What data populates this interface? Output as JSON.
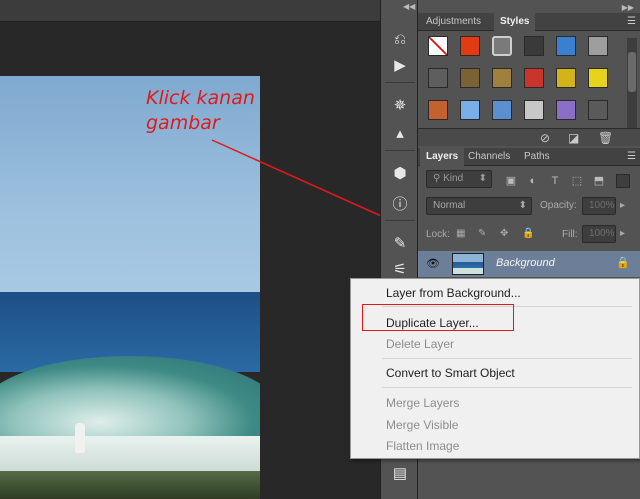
{
  "annotation": {
    "line1": "Klick kanan",
    "line2": "gambar",
    "color": "#e0191b"
  },
  "adjustments_panel": {
    "tabs": [
      {
        "label": "Adjustments",
        "active": false
      },
      {
        "label": "Styles",
        "active": true
      }
    ],
    "menu_icon": "panel-menu-icon",
    "style_swatches": [
      [
        "#ffffff",
        "#e23b12",
        "#7a7a7a",
        "#3a3a3a",
        "#3a7fd0",
        "#9e9e9e"
      ],
      [
        "#5e5e5e",
        "#7a6236",
        "#a0803c",
        "#c9352a",
        "#d4b21a",
        "#e7d21c"
      ],
      [
        "#c4622d",
        "#7aaee8",
        "#5b8fcf",
        "#c7c7c7",
        "#8b6ec7",
        "#5a5a5a"
      ]
    ],
    "footer_icons": [
      "no-style-icon",
      "new-style-icon",
      "delete-style-icon"
    ]
  },
  "layers_panel": {
    "tabs": [
      {
        "label": "Layers",
        "active": true
      },
      {
        "label": "Channels",
        "active": false
      },
      {
        "label": "Paths",
        "active": false
      }
    ],
    "filter_kind": "Kind",
    "blend_mode": "Normal",
    "opacity_label": "Opacity:",
    "opacity_value": "100%",
    "lock_label": "Lock:",
    "fill_label": "Fill:",
    "fill_value": "100%",
    "layer": {
      "name": "Background",
      "visible": true,
      "locked": true
    }
  },
  "context_menu": {
    "items": [
      {
        "label": "Layer from Background...",
        "enabled": true
      },
      {
        "label": "Duplicate Layer...",
        "enabled": true,
        "highlighted": true
      },
      {
        "label": "Delete Layer",
        "enabled": false
      },
      {
        "label": "Convert to Smart Object",
        "enabled": true
      },
      {
        "label": "Merge Layers",
        "enabled": false
      },
      {
        "label": "Merge Visible",
        "enabled": false
      },
      {
        "label": "Flatten Image",
        "enabled": false
      }
    ]
  },
  "tool_strip": {
    "icons": [
      "history-icon",
      "play-action-icon",
      "compass-icon",
      "histogram-icon",
      "3d-cube-icon",
      "info-icon",
      "brush-presets-icon",
      "tool-presets-icon",
      "notes-icon"
    ]
  }
}
